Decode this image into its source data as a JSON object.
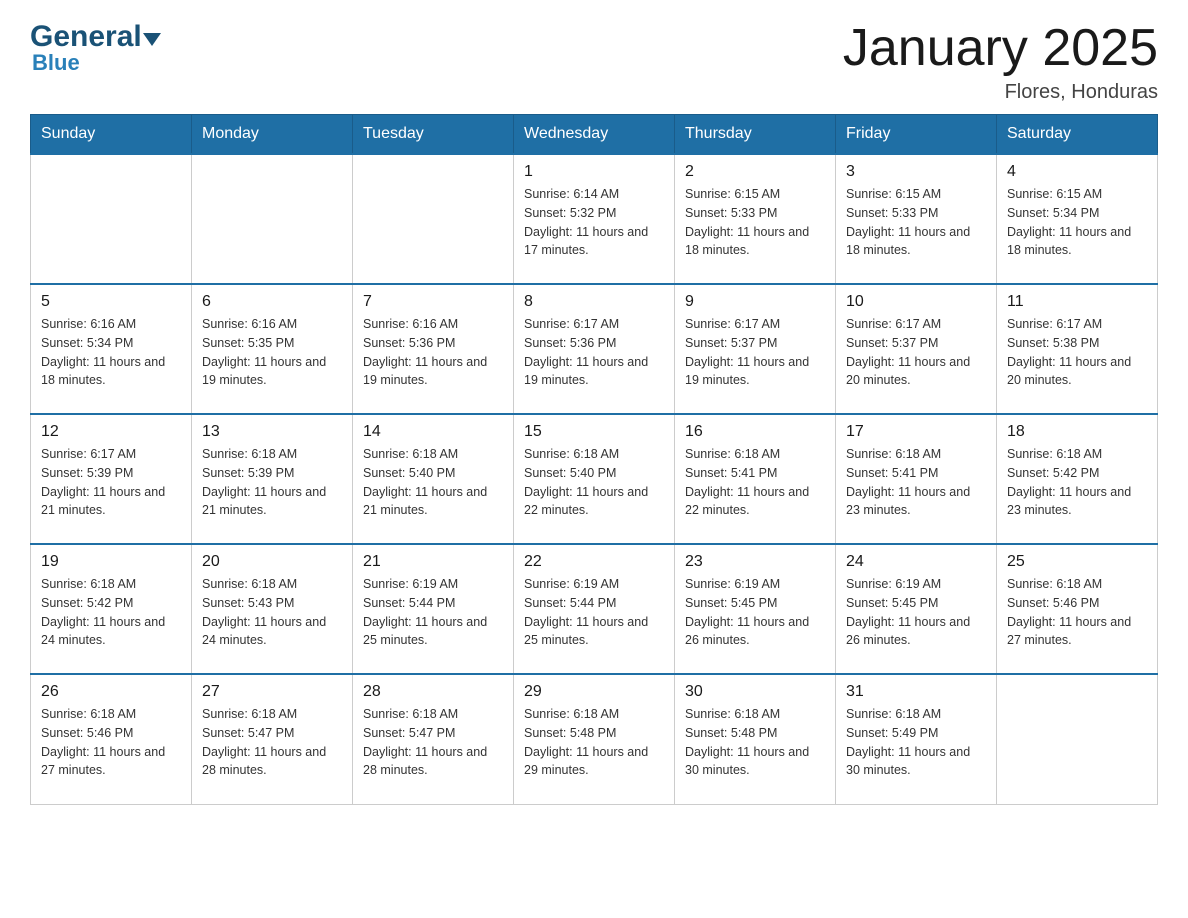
{
  "logo": {
    "general": "General",
    "blue": "Blue"
  },
  "title": "January 2025",
  "subtitle": "Flores, Honduras",
  "days_of_week": [
    "Sunday",
    "Monday",
    "Tuesday",
    "Wednesday",
    "Thursday",
    "Friday",
    "Saturday"
  ],
  "weeks": [
    [
      {
        "day": "",
        "info": ""
      },
      {
        "day": "",
        "info": ""
      },
      {
        "day": "",
        "info": ""
      },
      {
        "day": "1",
        "info": "Sunrise: 6:14 AM\nSunset: 5:32 PM\nDaylight: 11 hours and 17 minutes."
      },
      {
        "day": "2",
        "info": "Sunrise: 6:15 AM\nSunset: 5:33 PM\nDaylight: 11 hours and 18 minutes."
      },
      {
        "day": "3",
        "info": "Sunrise: 6:15 AM\nSunset: 5:33 PM\nDaylight: 11 hours and 18 minutes."
      },
      {
        "day": "4",
        "info": "Sunrise: 6:15 AM\nSunset: 5:34 PM\nDaylight: 11 hours and 18 minutes."
      }
    ],
    [
      {
        "day": "5",
        "info": "Sunrise: 6:16 AM\nSunset: 5:34 PM\nDaylight: 11 hours and 18 minutes."
      },
      {
        "day": "6",
        "info": "Sunrise: 6:16 AM\nSunset: 5:35 PM\nDaylight: 11 hours and 19 minutes."
      },
      {
        "day": "7",
        "info": "Sunrise: 6:16 AM\nSunset: 5:36 PM\nDaylight: 11 hours and 19 minutes."
      },
      {
        "day": "8",
        "info": "Sunrise: 6:17 AM\nSunset: 5:36 PM\nDaylight: 11 hours and 19 minutes."
      },
      {
        "day": "9",
        "info": "Sunrise: 6:17 AM\nSunset: 5:37 PM\nDaylight: 11 hours and 19 minutes."
      },
      {
        "day": "10",
        "info": "Sunrise: 6:17 AM\nSunset: 5:37 PM\nDaylight: 11 hours and 20 minutes."
      },
      {
        "day": "11",
        "info": "Sunrise: 6:17 AM\nSunset: 5:38 PM\nDaylight: 11 hours and 20 minutes."
      }
    ],
    [
      {
        "day": "12",
        "info": "Sunrise: 6:17 AM\nSunset: 5:39 PM\nDaylight: 11 hours and 21 minutes."
      },
      {
        "day": "13",
        "info": "Sunrise: 6:18 AM\nSunset: 5:39 PM\nDaylight: 11 hours and 21 minutes."
      },
      {
        "day": "14",
        "info": "Sunrise: 6:18 AM\nSunset: 5:40 PM\nDaylight: 11 hours and 21 minutes."
      },
      {
        "day": "15",
        "info": "Sunrise: 6:18 AM\nSunset: 5:40 PM\nDaylight: 11 hours and 22 minutes."
      },
      {
        "day": "16",
        "info": "Sunrise: 6:18 AM\nSunset: 5:41 PM\nDaylight: 11 hours and 22 minutes."
      },
      {
        "day": "17",
        "info": "Sunrise: 6:18 AM\nSunset: 5:41 PM\nDaylight: 11 hours and 23 minutes."
      },
      {
        "day": "18",
        "info": "Sunrise: 6:18 AM\nSunset: 5:42 PM\nDaylight: 11 hours and 23 minutes."
      }
    ],
    [
      {
        "day": "19",
        "info": "Sunrise: 6:18 AM\nSunset: 5:42 PM\nDaylight: 11 hours and 24 minutes."
      },
      {
        "day": "20",
        "info": "Sunrise: 6:18 AM\nSunset: 5:43 PM\nDaylight: 11 hours and 24 minutes."
      },
      {
        "day": "21",
        "info": "Sunrise: 6:19 AM\nSunset: 5:44 PM\nDaylight: 11 hours and 25 minutes."
      },
      {
        "day": "22",
        "info": "Sunrise: 6:19 AM\nSunset: 5:44 PM\nDaylight: 11 hours and 25 minutes."
      },
      {
        "day": "23",
        "info": "Sunrise: 6:19 AM\nSunset: 5:45 PM\nDaylight: 11 hours and 26 minutes."
      },
      {
        "day": "24",
        "info": "Sunrise: 6:19 AM\nSunset: 5:45 PM\nDaylight: 11 hours and 26 minutes."
      },
      {
        "day": "25",
        "info": "Sunrise: 6:18 AM\nSunset: 5:46 PM\nDaylight: 11 hours and 27 minutes."
      }
    ],
    [
      {
        "day": "26",
        "info": "Sunrise: 6:18 AM\nSunset: 5:46 PM\nDaylight: 11 hours and 27 minutes."
      },
      {
        "day": "27",
        "info": "Sunrise: 6:18 AM\nSunset: 5:47 PM\nDaylight: 11 hours and 28 minutes."
      },
      {
        "day": "28",
        "info": "Sunrise: 6:18 AM\nSunset: 5:47 PM\nDaylight: 11 hours and 28 minutes."
      },
      {
        "day": "29",
        "info": "Sunrise: 6:18 AM\nSunset: 5:48 PM\nDaylight: 11 hours and 29 minutes."
      },
      {
        "day": "30",
        "info": "Sunrise: 6:18 AM\nSunset: 5:48 PM\nDaylight: 11 hours and 30 minutes."
      },
      {
        "day": "31",
        "info": "Sunrise: 6:18 AM\nSunset: 5:49 PM\nDaylight: 11 hours and 30 minutes."
      },
      {
        "day": "",
        "info": ""
      }
    ]
  ]
}
